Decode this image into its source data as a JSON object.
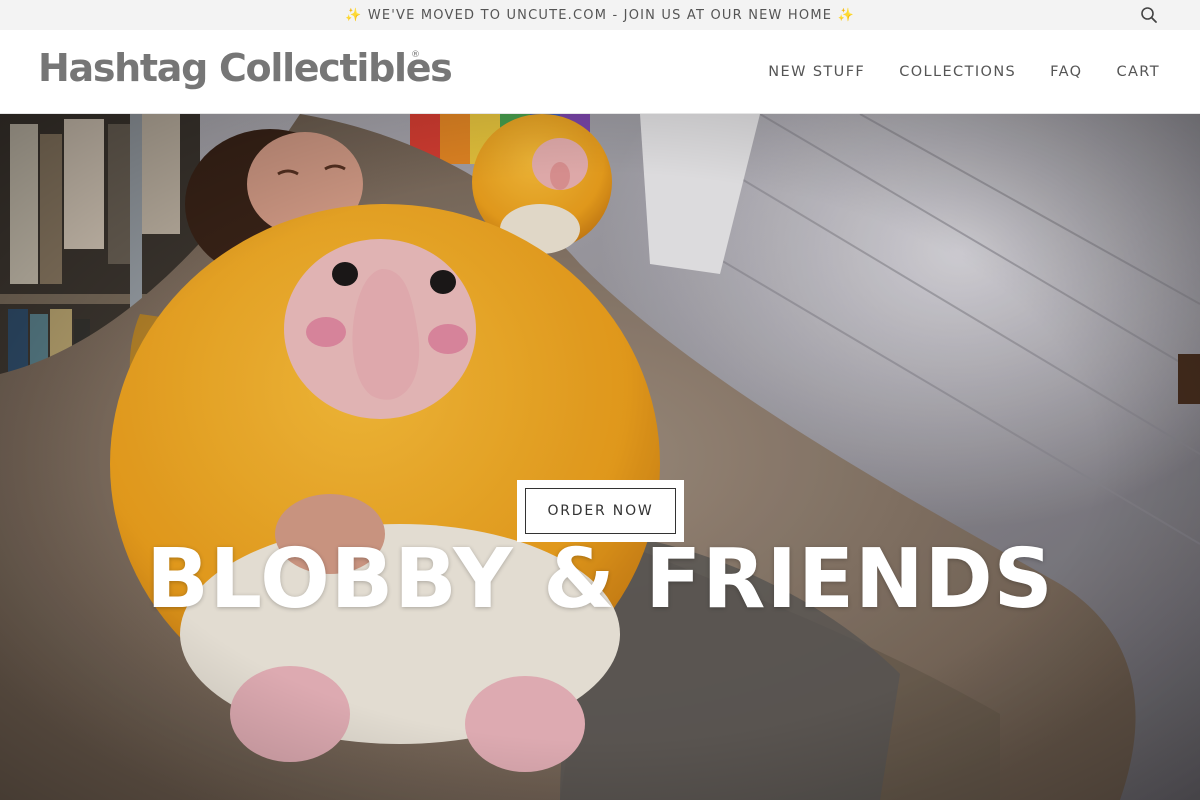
{
  "announcement": {
    "text": "✨ WE'VE MOVED TO UNCUTE.COM - JOIN US AT OUR NEW HOME ✨",
    "search_icon": "search-icon"
  },
  "header": {
    "logo": "Hashtag Collectibles",
    "logo_mark": "®",
    "nav": [
      {
        "label": "NEW STUFF"
      },
      {
        "label": "COLLECTIONS"
      },
      {
        "label": "FAQ"
      },
      {
        "label": "CART"
      }
    ]
  },
  "hero": {
    "button_label": "ORDER NOW",
    "title": "BLOBBY & FRIENDS",
    "image_subject": "person hugging orange fluffy plush toy on a fur couch"
  },
  "colors": {
    "announcement_bg": "#f3f3f3",
    "text_gray": "#555555",
    "logo_gray": "#767676",
    "plush_orange": "#f2a41e",
    "hero_title": "#ffffff"
  }
}
